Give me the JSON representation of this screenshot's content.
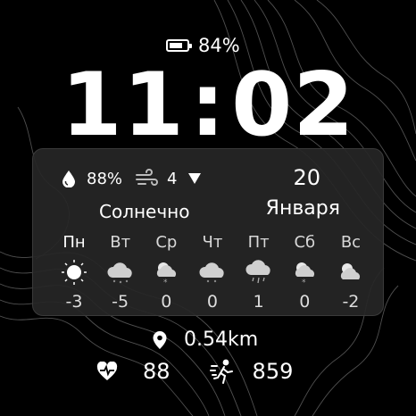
{
  "battery": {
    "percent_text": "84%",
    "level": 0.84,
    "icon": "battery-icon"
  },
  "time": {
    "hours": "11",
    "separator": ":",
    "minutes": "02"
  },
  "weather": {
    "humidity_text": "88%",
    "wind_speed": "4",
    "condition": "Солнечно",
    "icons": {
      "humidity": "water-drop-icon",
      "wind": "wind-icon",
      "wind_direction": "triangle-down-icon"
    }
  },
  "date": {
    "day": "20",
    "month": "Января"
  },
  "forecast": [
    {
      "day": "Пн",
      "icon": "sunny-icon",
      "temp": "-3"
    },
    {
      "day": "Вт",
      "icon": "cloudy-icon",
      "temp": "-5"
    },
    {
      "day": "Ср",
      "icon": "partly-cloudy-snow-icon",
      "temp": "0"
    },
    {
      "day": "Чт",
      "icon": "cloudy-icon",
      "temp": "0"
    },
    {
      "day": "Пт",
      "icon": "snow-rain-icon",
      "temp": "1"
    },
    {
      "day": "Сб",
      "icon": "partly-cloudy-snow-icon",
      "temp": "0"
    },
    {
      "day": "Вс",
      "icon": "partly-cloudy-icon",
      "temp": "-2"
    }
  ],
  "location": {
    "distance_text": "0.54km",
    "icon": "location-pin-icon"
  },
  "health": {
    "heart_rate": "88",
    "steps": "859",
    "icons": {
      "heart": "heart-rate-icon",
      "steps": "steps-icon"
    }
  },
  "colors": {
    "background": "#000000",
    "panel": "#262626",
    "text": "#ffffff"
  }
}
